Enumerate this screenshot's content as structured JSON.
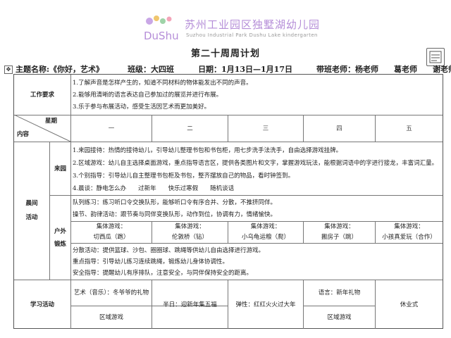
{
  "school": {
    "logo_mark_text": "DuShu",
    "name_cn": "苏州工业园区独墅湖幼儿园",
    "name_en": "Suzhou Industrial Park Dushu Lake kindergarten",
    "brand_color": "#b58ed8"
  },
  "plan_title": "第二十周周计划",
  "info": {
    "theme": "主题名称:《你好，艺术》",
    "class": "班级：大四班",
    "date": "日期：1月13日—1月17日",
    "teachers_label": "带班老师：杨老师",
    "teacher2": "葛老师",
    "teacher3": "谢老师"
  },
  "requirements": {
    "label": "工作要求",
    "items": [
      "1.了解声音是怎样产生的，知道不同材料的物体能发出不同的声音。",
      "2.能够用清晰的语言表达自己参加过的展览并进行布展。",
      "3.乐于参与布展活动，感受生活因艺术而更加美好。"
    ]
  },
  "header": {
    "week_label": "星期",
    "content_label": "内容",
    "days": [
      "一",
      "二",
      "三",
      "四",
      "五"
    ]
  },
  "morning": {
    "label_top": "晨间",
    "label_bottom": "活动",
    "arrival": {
      "label": "来园",
      "lines": [
        "1.来园接待：热情的接待幼儿，引导幼儿整理书包和书包柜，用七步洗手法洗手，自由选择游戏挂牌。",
        "2.区域游戏：幼儿自主选择桌面游戏，重点指导语言区，提供各类图片和文字，掌握游戏玩法，能根据词语中的字进行接龙，丰富词汇量。",
        "3.个别指导：引导幼儿自主整理书包柜及书包，整齐摆放自己的物品，看时钟签到。",
        "4.晨谈：静电怎么办　　过新年　　快乐过寒假　　随机谈话"
      ]
    },
    "outdoor": {
      "label_top": "户外",
      "label_bottom": "锻炼",
      "top_lines": [
        "队列练习：练习听口令交换队形，能够听口令有序合并、分散，不推挤同伴。",
        "操节、韵律活动：跟节奏与同伴变换队形，动作到位，协调有力，情绪愉快。"
      ],
      "games": [
        {
          "label": "集体游戏：",
          "name": "切西瓜（跑）"
        },
        {
          "label": "集体游戏：",
          "name": "伦敦桥（钻）"
        },
        {
          "label": "集体游戏：",
          "name": "小乌龟运粮（爬）"
        },
        {
          "label": "集体游戏：",
          "name": "搬房子（跳）"
        },
        {
          "label": "集体游戏：",
          "name": "小孩真爱玩（合作）"
        }
      ],
      "bottom_lines": [
        "分散活动：提供篮球、沙包、圈圈球、跳绳等供幼儿自由选择进行游戏。",
        "重点指导：引导幼儿练习连续跳绳，锻炼幼儿身体协调性。",
        "安全指导：提醒幼儿有序排队，注意安全，与同伴保持安全的距离。"
      ]
    }
  },
  "learning": {
    "label": "学习活动",
    "mon_top": "艺术（音乐）：冬爷爷的礼物",
    "mon_bottom": "区域游戏",
    "tue": "半日：迎新年集五福",
    "wed": "弹性：红红火火过大年",
    "thu_top": "语言：新年礼物",
    "thu_bottom": "区域游戏",
    "fri": "休业式"
  }
}
